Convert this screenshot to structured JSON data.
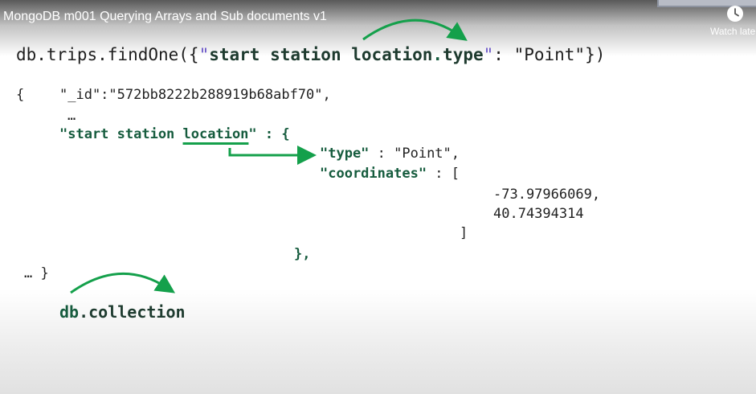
{
  "video": {
    "title": "MongoDB m001 Querying Arrays and Sub documents v1",
    "watch_later_label": "Watch later",
    "watch_later_icon": "clock-icon"
  },
  "query": {
    "prefix": "db.trips.findOne({",
    "quote_open": "\"",
    "key_part1": "start station location",
    "key_dot": ".",
    "key_part2": "type",
    "quote_close": "\"",
    "suffix": ": \"Point\"})"
  },
  "document": {
    "open_brace": "{",
    "id_line": "\"_id\":\"572bb8222b288919b68abf70\",",
    "ellipsis": "…",
    "field_prefix": "\"start station ",
    "field_location": "location",
    "field_suffix": "\" : {",
    "type_key": "\"type\"",
    "type_value": " : \"Point\",",
    "coordinates_key": "\"coordinates\"",
    "coordinates_open": " : [",
    "coord1": "-73.97966069,",
    "coord2": "40.74394314",
    "coordinates_close": "]",
    "sub_close": "},",
    "doc_close": "… }"
  },
  "footer": {
    "db_part": "db",
    "collection_part": ".collection"
  },
  "colors": {
    "arrow_green": "#14a04b",
    "key_dark_green": "#165c3e",
    "quote_purple": "#6a56c8"
  }
}
